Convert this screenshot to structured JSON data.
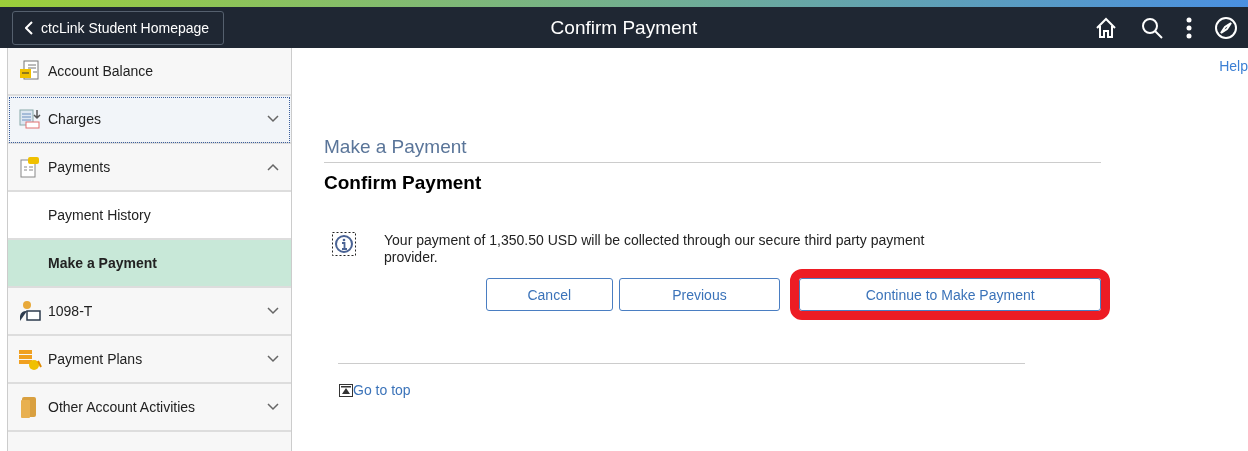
{
  "header": {
    "back_button": "ctcLink Student Homepage",
    "title": "Confirm Payment"
  },
  "sidebar": {
    "items": [
      {
        "kind": "section",
        "label": "Account Balance",
        "focused": false
      },
      {
        "kind": "section",
        "label": "Charges",
        "expanded": false,
        "focused": true
      },
      {
        "kind": "section",
        "label": "Payments",
        "expanded": true,
        "focused": false
      },
      {
        "kind": "subitem",
        "label": "Payment History",
        "selected": false
      },
      {
        "kind": "subitem",
        "label": "Make a Payment",
        "selected": true
      },
      {
        "kind": "section",
        "label": "1098-T",
        "expanded": false,
        "focused": false
      },
      {
        "kind": "section",
        "label": "Payment Plans",
        "expanded": false,
        "focused": false
      },
      {
        "kind": "section",
        "label": "Other Account Activities",
        "expanded": false,
        "focused": false
      }
    ]
  },
  "help_link": "Help",
  "page": {
    "subtitle": "Make a Payment",
    "heading": "Confirm Payment",
    "message": "Your payment of 1,350.50 USD will be collected through our secure third party payment provider.",
    "buttons": [
      {
        "label": "Cancel",
        "highlighted": false
      },
      {
        "label": "Previous",
        "highlighted": false
      },
      {
        "label": "Continue to Make Payment",
        "highlighted": true
      }
    ],
    "go_to_top": "Go to top"
  }
}
